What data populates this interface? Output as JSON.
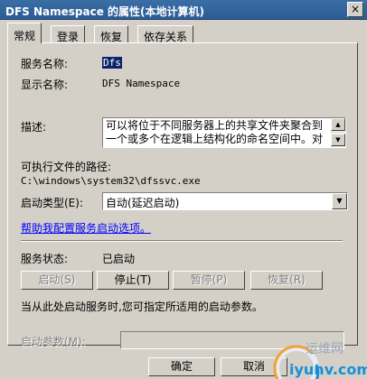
{
  "window": {
    "title": "DFS Namespace 的属性(本地计算机)",
    "close_label": "×"
  },
  "tabs": [
    {
      "label": "常规"
    },
    {
      "label": "登录"
    },
    {
      "label": "恢复"
    },
    {
      "label": "依存关系"
    }
  ],
  "general": {
    "service_name_label": "服务名称:",
    "service_name_value": "Dfs",
    "display_name_label": "显示名称:",
    "display_name_value": "DFS Namespace",
    "description_label": "描述:",
    "description_value": "可以将位于不同服务器上的共享文件夹聚合到一个或多个在逻辑上结构化的命名空间中。对",
    "path_label": "可执行文件的路径:",
    "path_value": "C:\\windows\\system32\\dfssvc.exe",
    "startup_type_label": "启动类型(E):",
    "startup_type_value": "自动(延迟启动)",
    "help_link": "帮助我配置服务启动选项。",
    "service_status_label": "服务状态:",
    "service_status_value": "已启动",
    "start_button": "启动(S)",
    "stop_button": "停止(T)",
    "pause_button": "暂停(P)",
    "resume_button": "恢复(R)",
    "params_note": "当从此处启动服务时,您可指定所适用的启动参数。",
    "start_params_label": "启动参数(M):",
    "start_params_value": ""
  },
  "footer": {
    "ok_button": "确定",
    "cancel_button": "取消"
  },
  "watermark": {
    "line1": "运维网",
    "line2": "iyunv.com"
  },
  "icons": {
    "scroll_up": "▲",
    "scroll_down": "▼",
    "dropdown": "▼"
  }
}
